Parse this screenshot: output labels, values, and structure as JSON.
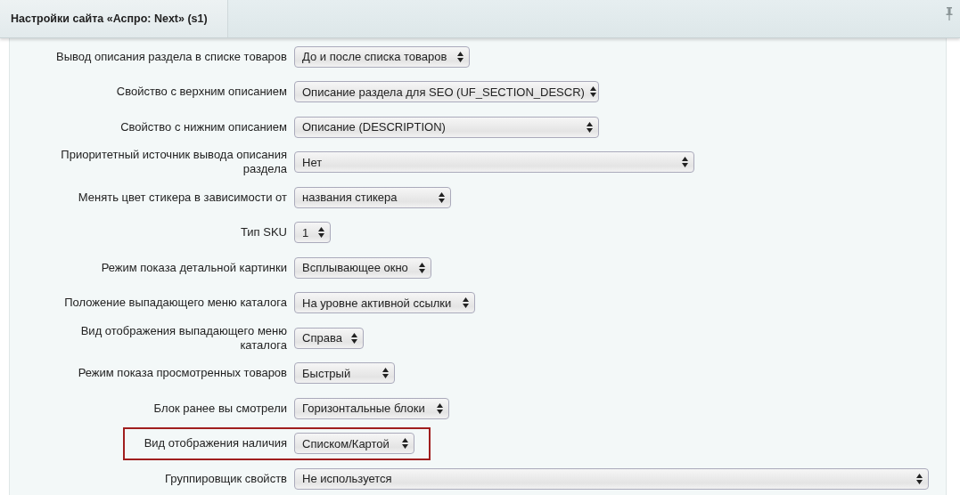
{
  "tab": {
    "title": "Настройки сайта «Аспро: Next» (s1)",
    "selected": true
  },
  "rows": [
    {
      "label": "Вывод описания раздела в списке товаров",
      "value": "До и после списка товаров",
      "highlighted": false
    },
    {
      "label": "Свойство с верхним описанием",
      "value": "Описание раздела для SEO (UF_SECTION_DESCR)",
      "highlighted": false
    },
    {
      "label": "Свойство с нижним описанием",
      "value": "Описание (DESCRIPTION)",
      "highlighted": false
    },
    {
      "label": "Приоритетный источник вывода описания раздела",
      "value": "Нет",
      "highlighted": false
    },
    {
      "label": "Менять цвет стикера в зависимости от",
      "value": "названия стикера",
      "highlighted": false
    },
    {
      "label": "Тип SKU",
      "value": "1",
      "highlighted": false
    },
    {
      "label": "Режим показа детальной картинки",
      "value": "Всплывающее окно",
      "highlighted": false
    },
    {
      "label": "Положение выпадающего меню каталога",
      "value": "На уровне активной ссылки",
      "highlighted": false
    },
    {
      "label": "Вид отображения выпадающего меню каталога",
      "value": "Справа",
      "highlighted": false
    },
    {
      "label": "Режим показа просмотренных товаров",
      "value": "Быстрый",
      "highlighted": false
    },
    {
      "label": "Блок ранее вы смотрели",
      "value": "Горизонтальные блоки",
      "highlighted": false
    },
    {
      "label": "Вид отображения наличия",
      "value": "Списком/Картой",
      "highlighted": true
    },
    {
      "label": "Группировщик свойств",
      "value": "Не используется",
      "highlighted": false
    }
  ]
}
